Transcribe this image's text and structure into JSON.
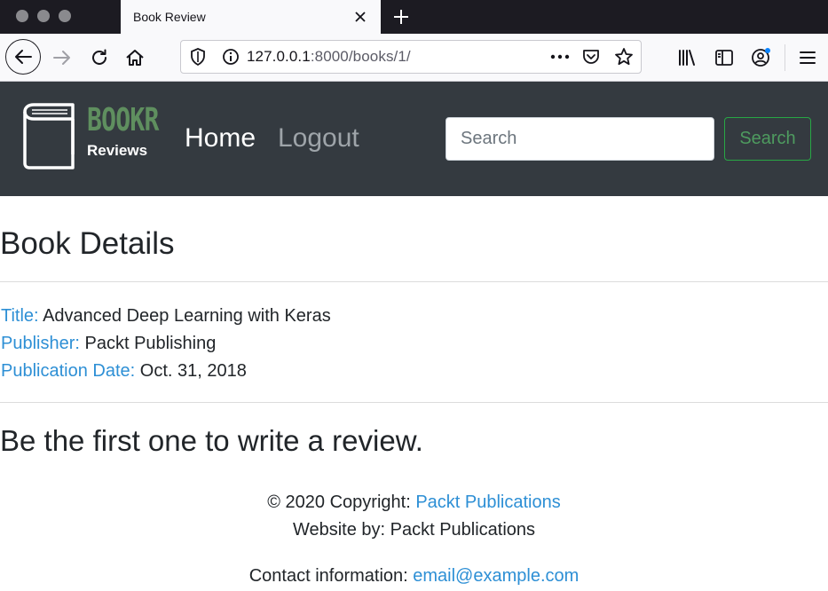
{
  "browser": {
    "tab_title": "Book Review",
    "url_host": "127.0.0.1",
    "url_path": ":8000/books/1/"
  },
  "site": {
    "brand_name": "BOOKR",
    "brand_sub": "Reviews",
    "nav": {
      "home": "Home",
      "logout": "Logout"
    },
    "search": {
      "placeholder": "Search",
      "button": "Search"
    }
  },
  "main": {
    "title": "Book Details",
    "details": [
      {
        "label": "Title:",
        "value": "Advanced Deep Learning with Keras"
      },
      {
        "label": "Publisher:",
        "value": "Packt Publishing"
      },
      {
        "label": "Publication Date:",
        "value": "Oct. 31, 2018"
      }
    ],
    "review_message": "Be the first one to write a review."
  },
  "footer": {
    "copyright_prefix": "© 2020 Copyright: ",
    "copyright_link": "Packt Publications",
    "website_by": "Website by: Packt Publications",
    "contact_prefix": "Contact information: ",
    "contact_email": "email@example.com"
  },
  "colors": {
    "header_bg": "#343a40",
    "brand_green": "#5f8f5f",
    "link_blue": "#2d8fd5",
    "search_button_border": "#28a745"
  }
}
